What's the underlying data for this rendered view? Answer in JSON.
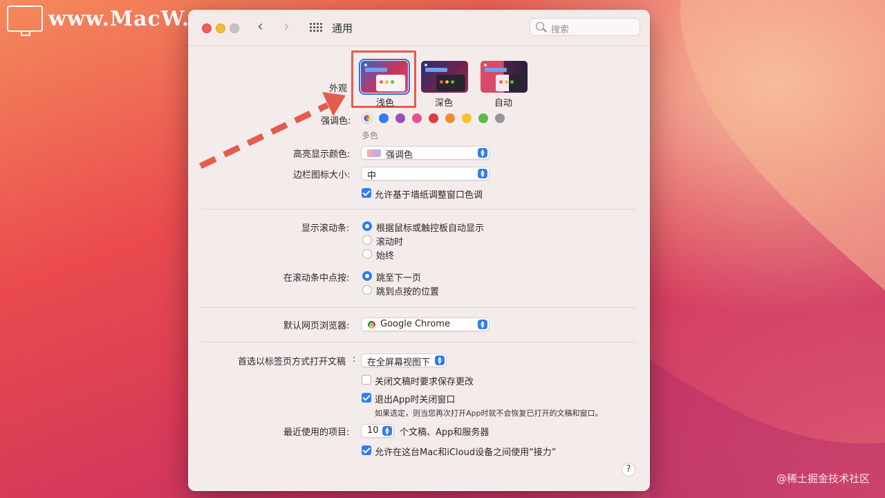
{
  "watermark": {
    "text": "www.MacW.com"
  },
  "credit": {
    "text": "@稀土掘金技术社区"
  },
  "window": {
    "title": "通用",
    "search_placeholder": "搜索"
  },
  "appearance": {
    "label": "外观",
    "options": [
      "浅色",
      "深色",
      "自动"
    ],
    "selected": "浅色"
  },
  "accent": {
    "label": "强调色:",
    "selected_caption": "多色",
    "colors": [
      "multicolor",
      "#2f7cf6",
      "#9b4fb6",
      "#e6518f",
      "#e0393e",
      "#f28c28",
      "#f5c52a",
      "#5fb84a",
      "#9a9696"
    ]
  },
  "highlight": {
    "label": "高亮显示颜色:",
    "value": "强调色"
  },
  "sidebar_icon": {
    "label": "边栏图标大小:",
    "value": "中"
  },
  "wallpaper_tint": {
    "label": "允许基于墙纸调整窗口色调",
    "checked": true
  },
  "scrollbars": {
    "label": "显示滚动条:",
    "options": [
      "根据鼠标或触控板自动显示",
      "滚动时",
      "始终"
    ],
    "selected": 0
  },
  "click_scroll": {
    "label": "在滚动条中点按:",
    "options": [
      "跳至下一页",
      "跳到点按的位置"
    ],
    "selected": 0
  },
  "browser": {
    "label": "默认网页浏览器:",
    "value": "Google Chrome"
  },
  "tabs": {
    "label": "首选以标签页方式打开文稿",
    "value": "在全屏幕视图下"
  },
  "ask_save": {
    "label": "关闭文稿时要求保存更改",
    "checked": false
  },
  "close_windows": {
    "label": "退出App时关闭窗口",
    "checked": true,
    "note": "如果选定，则当您再次打开App时就不会恢复已打开的文稿和窗口。"
  },
  "recent": {
    "label": "最近使用的项目:",
    "value": "10",
    "suffix": "个文稿、App和服务器"
  },
  "handoff": {
    "label": "允许在这台Mac和iCloud设备之间使用“接力”",
    "checked": true
  },
  "help": {
    "label": "?"
  },
  "colors": {
    "accent": "#2f7cf6",
    "annotation": "#e35c4e"
  }
}
